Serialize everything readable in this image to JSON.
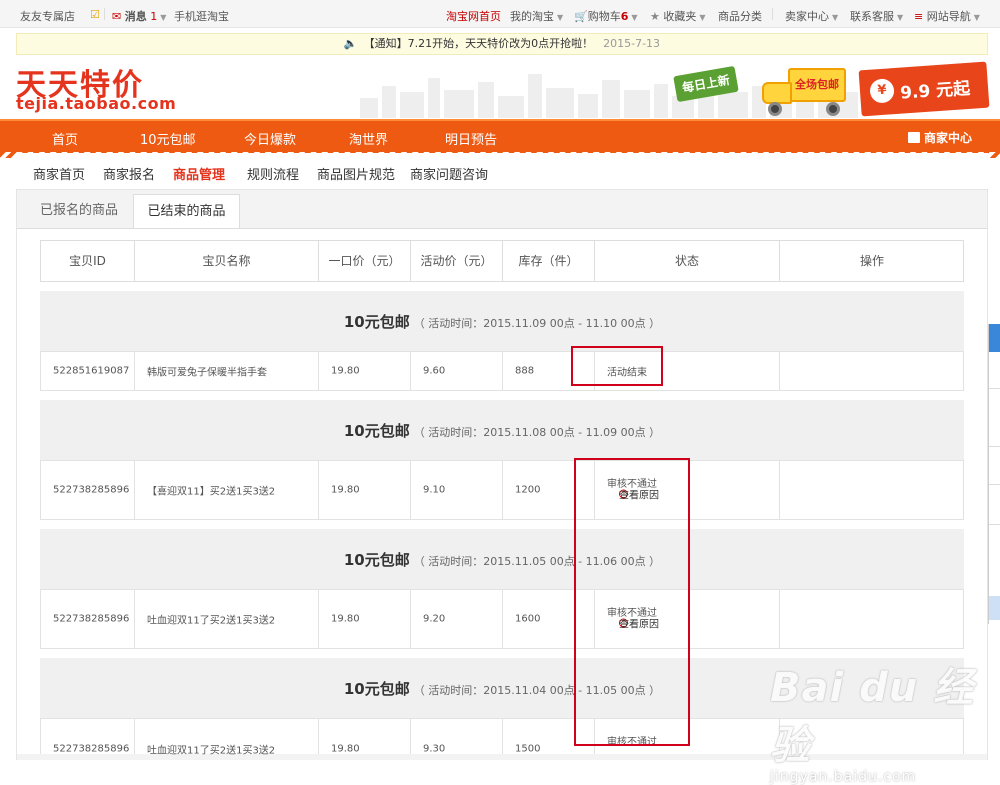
{
  "topbar": {
    "shop": "友友专属店",
    "messages_label": "消息",
    "messages_count": "1",
    "mobile": "手机逛淘宝",
    "taobao_home": "淘宝网首页",
    "my_taobao": "我的淘宝",
    "cart_label": "购物车",
    "cart_count": "6",
    "favorites": "收藏夹",
    "categories": "商品分类",
    "seller_center": "卖家中心",
    "contact": "联系客服",
    "site_nav": "网站导航"
  },
  "notice": {
    "text": "【通知】7.21开始，天天特价改为0点开抢啦！",
    "date": "2015-7-13"
  },
  "header": {
    "logo_cn": "天天特价",
    "logo_en": "tejia.taobao.com",
    "daily_new": "每日上新",
    "free_shipping": "全场包邮",
    "price_badge": "9.9 元起",
    "yen": "¥"
  },
  "nav": {
    "items": [
      "首页",
      "10元包邮",
      "今日爆款",
      "淘世界",
      "明日预告"
    ],
    "merchant_center": "商家中心"
  },
  "subnav": {
    "items": [
      "商家首页",
      "商家报名",
      "商品管理",
      "规则流程",
      "商品图片规范",
      "商家问题咨询"
    ],
    "active_index": 2
  },
  "tabs": {
    "registered": "已报名的商品",
    "ended": "已结束的商品"
  },
  "table": {
    "headers": [
      "宝贝ID",
      "宝贝名称",
      "一口价（元）",
      "活动价（元）",
      "库存（件）",
      "状态",
      "操作"
    ],
    "reason_link": "查看原因",
    "groups": [
      {
        "name": "10元包邮",
        "time": "（ 活动时间：2015.11.09 00点 - 11.10 00点 ）",
        "row": {
          "id": "522851619087",
          "title": "韩版可爱兔子保暖半指手套",
          "price": "19.80",
          "promo": "9.60",
          "stock": "888",
          "status": "活动结束"
        }
      },
      {
        "name": "10元包邮",
        "time": "（ 活动时间：2015.11.08 00点 - 11.09 00点 ）",
        "row": {
          "id": "522738285896",
          "title": "【喜迎双11】买2送1买3送2",
          "price": "19.80",
          "promo": "9.10",
          "stock": "1200",
          "status": "审核不通过"
        }
      },
      {
        "name": "10元包邮",
        "time": "（ 活动时间：2015.11.05 00点 - 11.06 00点 ）",
        "row": {
          "id": "522738285896",
          "title": "吐血迎双11了买2送1买3送2",
          "price": "19.80",
          "promo": "9.20",
          "stock": "1600",
          "status": "审核不通过"
        }
      },
      {
        "name": "10元包邮",
        "time": "（ 活动时间：2015.11.04 00点 - 11.05 00点 ）",
        "row": {
          "id": "522738285896",
          "title": "吐血迎双11了买2送1买3送2",
          "price": "19.80",
          "promo": "9.30",
          "stock": "1500",
          "status": "审核不通过"
        }
      }
    ]
  },
  "watermark": {
    "brand": "Bai du 经验",
    "url": "jingyan.baidu.com"
  },
  "colors": {
    "brand_red": "#e4341e",
    "nav_orange": "#ef5a12",
    "annotation_red": "#d0021b"
  }
}
